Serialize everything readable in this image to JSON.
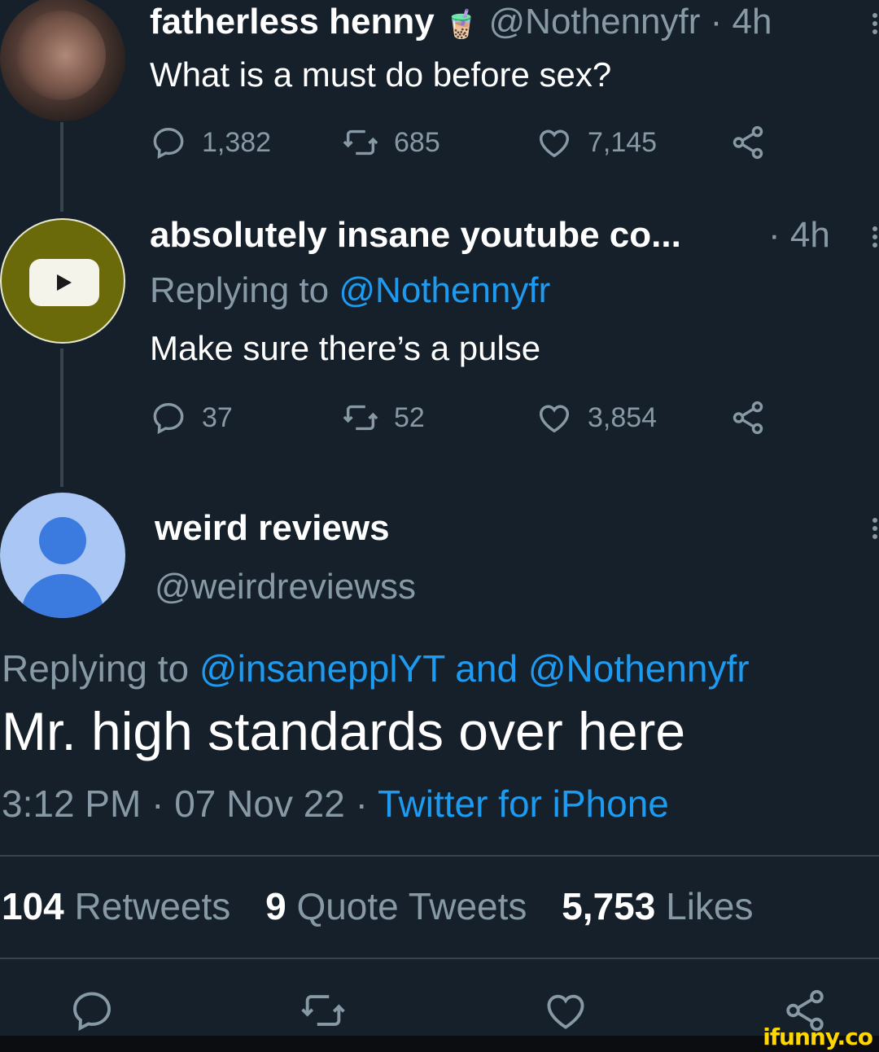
{
  "tweet1": {
    "name": "fatherless henny",
    "emoji": "🧋",
    "handle_time": "@Nothennyfr · 4h",
    "text": "What is a must do before sex?",
    "replies": "1,382",
    "retweets": "685",
    "likes": "7,145"
  },
  "tweet2": {
    "name": "absolutely insane youtube co...",
    "time": "· 4h",
    "replying_label": "Replying to",
    "replying_to": "@Nothennyfr",
    "text": "Make sure there’s a pulse",
    "replies": "37",
    "retweets": "52",
    "likes": "3,854"
  },
  "main_tweet": {
    "name": "weird reviews",
    "handle": "@weirdreviewss",
    "replying_label": "Replying to",
    "replying_to_1": "@insanepplYT",
    "replying_and": "and",
    "replying_to_2": "@Nothennyfr",
    "text": "Mr. high standards over here",
    "timestamp": "3:12 PM · 07 Nov 22 ·",
    "source": "Twitter for iPhone",
    "retweets_count": "104",
    "retweets_label": "Retweets",
    "quotes_count": "9",
    "quotes_label": "Quote Tweets",
    "likes_count": "5,753",
    "likes_label": "Likes"
  },
  "watermark": "ifunny.co",
  "colors": {
    "background": "#15202b",
    "muted": "#8899a6",
    "link": "#1d9bf0",
    "divider": "#38444d"
  }
}
